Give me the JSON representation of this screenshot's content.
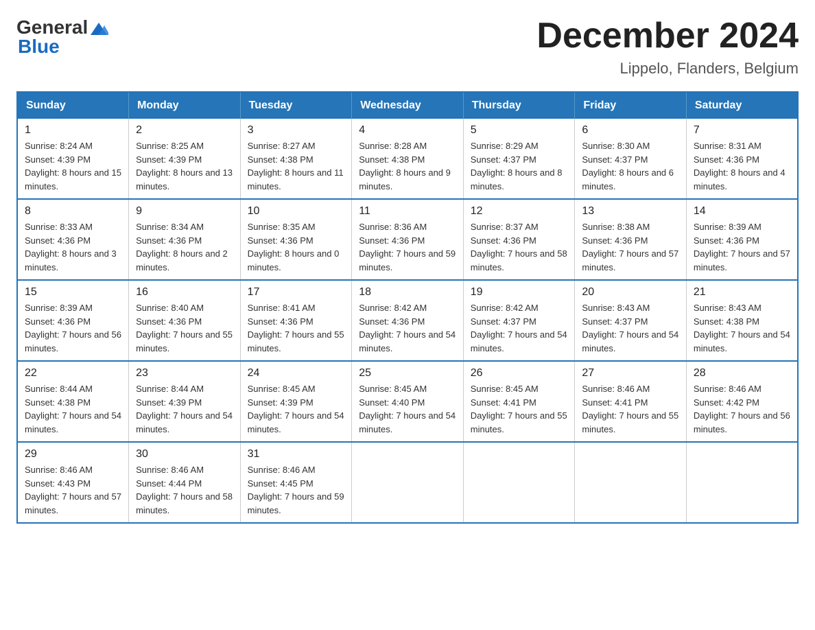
{
  "header": {
    "logo_general": "General",
    "logo_blue": "Blue",
    "title": "December 2024",
    "subtitle": "Lippelo, Flanders, Belgium"
  },
  "weekdays": [
    "Sunday",
    "Monday",
    "Tuesday",
    "Wednesday",
    "Thursday",
    "Friday",
    "Saturday"
  ],
  "weeks": [
    [
      {
        "day": "1",
        "sunrise": "8:24 AM",
        "sunset": "4:39 PM",
        "daylight": "8 hours and 15 minutes."
      },
      {
        "day": "2",
        "sunrise": "8:25 AM",
        "sunset": "4:39 PM",
        "daylight": "8 hours and 13 minutes."
      },
      {
        "day": "3",
        "sunrise": "8:27 AM",
        "sunset": "4:38 PM",
        "daylight": "8 hours and 11 minutes."
      },
      {
        "day": "4",
        "sunrise": "8:28 AM",
        "sunset": "4:38 PM",
        "daylight": "8 hours and 9 minutes."
      },
      {
        "day": "5",
        "sunrise": "8:29 AM",
        "sunset": "4:37 PM",
        "daylight": "8 hours and 8 minutes."
      },
      {
        "day": "6",
        "sunrise": "8:30 AM",
        "sunset": "4:37 PM",
        "daylight": "8 hours and 6 minutes."
      },
      {
        "day": "7",
        "sunrise": "8:31 AM",
        "sunset": "4:36 PM",
        "daylight": "8 hours and 4 minutes."
      }
    ],
    [
      {
        "day": "8",
        "sunrise": "8:33 AM",
        "sunset": "4:36 PM",
        "daylight": "8 hours and 3 minutes."
      },
      {
        "day": "9",
        "sunrise": "8:34 AM",
        "sunset": "4:36 PM",
        "daylight": "8 hours and 2 minutes."
      },
      {
        "day": "10",
        "sunrise": "8:35 AM",
        "sunset": "4:36 PM",
        "daylight": "8 hours and 0 minutes."
      },
      {
        "day": "11",
        "sunrise": "8:36 AM",
        "sunset": "4:36 PM",
        "daylight": "7 hours and 59 minutes."
      },
      {
        "day": "12",
        "sunrise": "8:37 AM",
        "sunset": "4:36 PM",
        "daylight": "7 hours and 58 minutes."
      },
      {
        "day": "13",
        "sunrise": "8:38 AM",
        "sunset": "4:36 PM",
        "daylight": "7 hours and 57 minutes."
      },
      {
        "day": "14",
        "sunrise": "8:39 AM",
        "sunset": "4:36 PM",
        "daylight": "7 hours and 57 minutes."
      }
    ],
    [
      {
        "day": "15",
        "sunrise": "8:39 AM",
        "sunset": "4:36 PM",
        "daylight": "7 hours and 56 minutes."
      },
      {
        "day": "16",
        "sunrise": "8:40 AM",
        "sunset": "4:36 PM",
        "daylight": "7 hours and 55 minutes."
      },
      {
        "day": "17",
        "sunrise": "8:41 AM",
        "sunset": "4:36 PM",
        "daylight": "7 hours and 55 minutes."
      },
      {
        "day": "18",
        "sunrise": "8:42 AM",
        "sunset": "4:36 PM",
        "daylight": "7 hours and 54 minutes."
      },
      {
        "day": "19",
        "sunrise": "8:42 AM",
        "sunset": "4:37 PM",
        "daylight": "7 hours and 54 minutes."
      },
      {
        "day": "20",
        "sunrise": "8:43 AM",
        "sunset": "4:37 PM",
        "daylight": "7 hours and 54 minutes."
      },
      {
        "day": "21",
        "sunrise": "8:43 AM",
        "sunset": "4:38 PM",
        "daylight": "7 hours and 54 minutes."
      }
    ],
    [
      {
        "day": "22",
        "sunrise": "8:44 AM",
        "sunset": "4:38 PM",
        "daylight": "7 hours and 54 minutes."
      },
      {
        "day": "23",
        "sunrise": "8:44 AM",
        "sunset": "4:39 PM",
        "daylight": "7 hours and 54 minutes."
      },
      {
        "day": "24",
        "sunrise": "8:45 AM",
        "sunset": "4:39 PM",
        "daylight": "7 hours and 54 minutes."
      },
      {
        "day": "25",
        "sunrise": "8:45 AM",
        "sunset": "4:40 PM",
        "daylight": "7 hours and 54 minutes."
      },
      {
        "day": "26",
        "sunrise": "8:45 AM",
        "sunset": "4:41 PM",
        "daylight": "7 hours and 55 minutes."
      },
      {
        "day": "27",
        "sunrise": "8:46 AM",
        "sunset": "4:41 PM",
        "daylight": "7 hours and 55 minutes."
      },
      {
        "day": "28",
        "sunrise": "8:46 AM",
        "sunset": "4:42 PM",
        "daylight": "7 hours and 56 minutes."
      }
    ],
    [
      {
        "day": "29",
        "sunrise": "8:46 AM",
        "sunset": "4:43 PM",
        "daylight": "7 hours and 57 minutes."
      },
      {
        "day": "30",
        "sunrise": "8:46 AM",
        "sunset": "4:44 PM",
        "daylight": "7 hours and 58 minutes."
      },
      {
        "day": "31",
        "sunrise": "8:46 AM",
        "sunset": "4:45 PM",
        "daylight": "7 hours and 59 minutes."
      },
      null,
      null,
      null,
      null
    ]
  ],
  "labels": {
    "sunrise": "Sunrise:",
    "sunset": "Sunset:",
    "daylight": "Daylight:"
  }
}
